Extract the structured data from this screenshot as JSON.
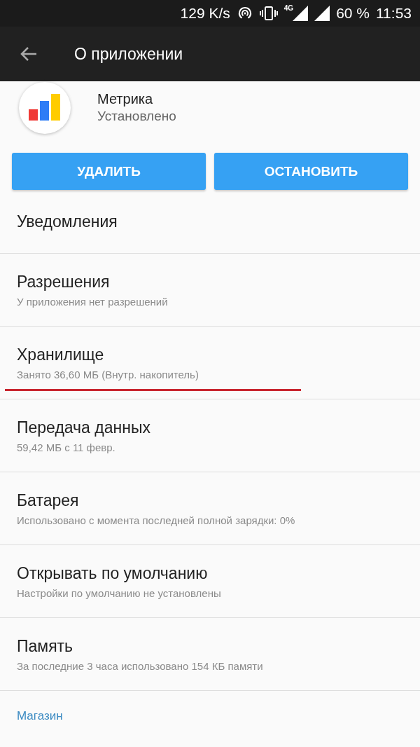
{
  "status_bar": {
    "speed": "129 K/s",
    "network": "4G",
    "battery": "60 %",
    "time": "11:53"
  },
  "toolbar": {
    "title": "О приложении"
  },
  "app": {
    "name": "Метрика",
    "status": "Установлено"
  },
  "buttons": [
    "УДАЛИТЬ",
    "ОСТАНОВИТЬ"
  ],
  "items": [
    {
      "title": "Уведомления",
      "underlined": false
    },
    {
      "title": "Разрешения",
      "subtitle": "У приложения нет разрешений",
      "underlined": false
    },
    {
      "title": "Хранилище",
      "subtitle": "Занято 36,60 МБ (Внутр. накопитель)",
      "underlined": true
    },
    {
      "title": "Передача данных",
      "subtitle": "59,42 МБ с 11 февр.",
      "underlined": false
    },
    {
      "title": "Батарея",
      "subtitle": "Использовано с момента последней полной зарядки: 0%",
      "underlined": false
    },
    {
      "title": "Открывать по умолчанию",
      "subtitle": "Настройки по умолчанию не установлены",
      "underlined": false
    },
    {
      "title": "Память",
      "subtitle": "За последние 3 часа использовано 154 КБ памяти",
      "underlined": false
    }
  ],
  "section_header": "Магазин"
}
